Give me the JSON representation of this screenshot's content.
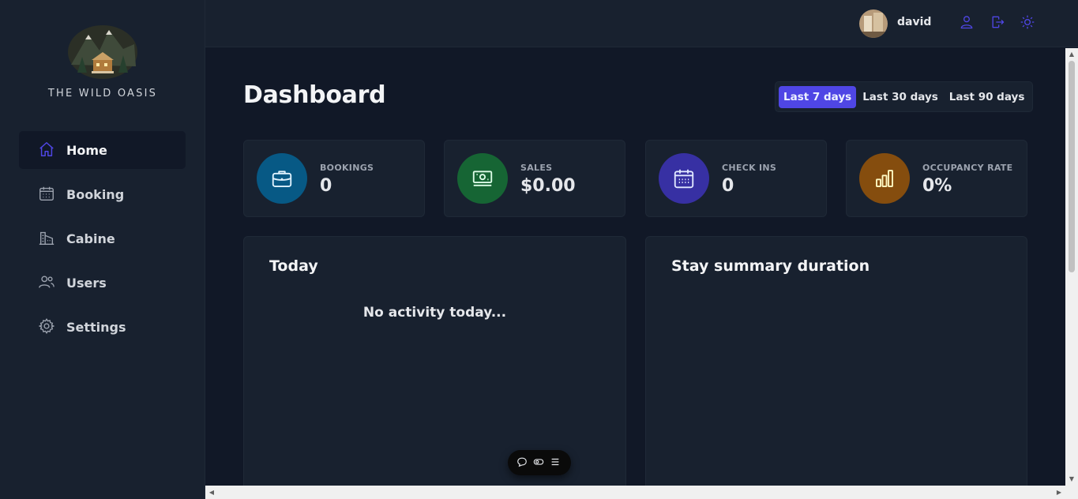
{
  "brand": {
    "name": "THE WILD OASIS"
  },
  "sidebar": {
    "items": [
      {
        "label": "Home",
        "icon": "home-icon",
        "active": true
      },
      {
        "label": "Booking",
        "icon": "calendar-icon"
      },
      {
        "label": "Cabine",
        "icon": "cabin-icon"
      },
      {
        "label": "Users",
        "icon": "users-icon"
      },
      {
        "label": "Settings",
        "icon": "gear-icon"
      }
    ]
  },
  "header": {
    "username": "david",
    "icons": [
      "user-icon",
      "logout-icon",
      "sun-icon"
    ],
    "accent": "#4f46e5"
  },
  "dashboard": {
    "title": "Dashboard",
    "filters": [
      {
        "label": "Last 7 days",
        "active": true
      },
      {
        "label": "Last 30 days"
      },
      {
        "label": "Last 90 days"
      }
    ],
    "stats": [
      {
        "label": "BOOKINGS",
        "value": "0",
        "icon": "briefcase-icon",
        "color": "#075985"
      },
      {
        "label": "SALES",
        "value": "$0.00",
        "icon": "banknotes-icon",
        "color": "#166534"
      },
      {
        "label": "CHECK INS",
        "value": "0",
        "icon": "calendar-days-icon",
        "color": "#3730a3"
      },
      {
        "label": "OCCUPANCY RATE",
        "value": "0%",
        "icon": "chart-bar-icon",
        "color": "#854d0e"
      }
    ],
    "today": {
      "title": "Today",
      "empty": "No activity today..."
    },
    "summary": {
      "title": "Stay summary duration"
    }
  }
}
